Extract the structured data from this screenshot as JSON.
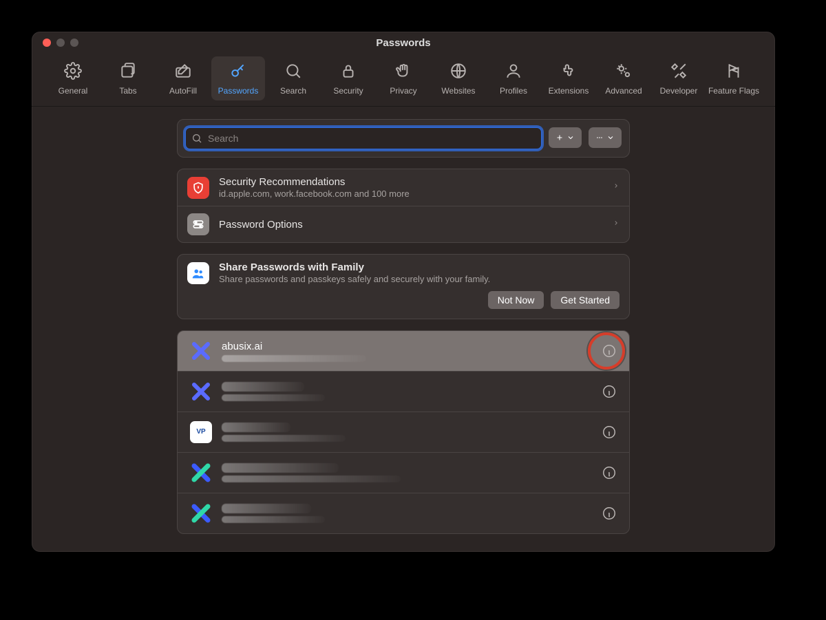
{
  "window": {
    "title": "Passwords"
  },
  "toolbar": {
    "items": [
      {
        "id": "general",
        "label": "General"
      },
      {
        "id": "tabs",
        "label": "Tabs"
      },
      {
        "id": "autofill",
        "label": "AutoFill"
      },
      {
        "id": "passwords",
        "label": "Passwords",
        "active": true
      },
      {
        "id": "search",
        "label": "Search"
      },
      {
        "id": "security",
        "label": "Security"
      },
      {
        "id": "privacy",
        "label": "Privacy"
      },
      {
        "id": "websites",
        "label": "Websites"
      },
      {
        "id": "profiles",
        "label": "Profiles"
      },
      {
        "id": "extensions",
        "label": "Extensions"
      },
      {
        "id": "advanced",
        "label": "Advanced"
      },
      {
        "id": "developer",
        "label": "Developer"
      },
      {
        "id": "featureflags",
        "label": "Feature Flags"
      }
    ]
  },
  "search": {
    "placeholder": "Search",
    "value": ""
  },
  "sections": {
    "recommendations": {
      "title": "Security Recommendations",
      "subtitle": "id.apple.com, work.facebook.com and 100 more"
    },
    "options": {
      "title": "Password Options"
    },
    "share": {
      "title": "Share Passwords with Family",
      "subtitle": "Share passwords and passkeys safely and securely with your family.",
      "not_now": "Not Now",
      "get_started": "Get Started"
    }
  },
  "passwords": [
    {
      "site": "abusix.ai",
      "icon": "x-blue",
      "selected": true,
      "highlighted_info": true
    },
    {
      "site": "",
      "icon": "x-blue",
      "selected": false
    },
    {
      "site": "",
      "icon": "vp",
      "selected": false
    },
    {
      "site": "",
      "icon": "x-teal",
      "selected": false
    },
    {
      "site": "",
      "icon": "x-teal",
      "selected": false
    }
  ]
}
